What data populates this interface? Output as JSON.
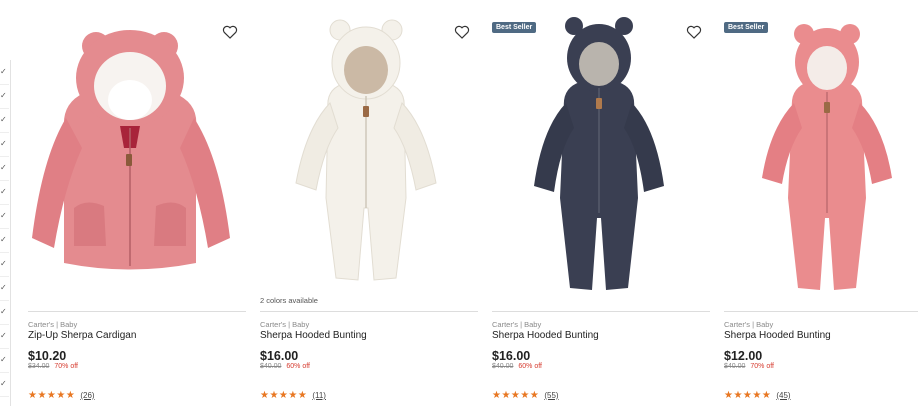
{
  "filter_checks": [
    "✓",
    "✓",
    "✓",
    "✓",
    "✓",
    "✓",
    "✓",
    "✓",
    "✓",
    "✓",
    "✓",
    "✓",
    "✓",
    "✓"
  ],
  "colors": {
    "accent_orange": "#e87722",
    "sale_red": "#d63b2f",
    "badge_blue": "#4f6a83",
    "pink": "#e48b8f",
    "cream": "#f4f1ea",
    "navy": "#3a3f52",
    "coral": "#ea8c8e"
  },
  "products": [
    {
      "image": "pink-sherpa-cardigan",
      "badge": "",
      "colors_available": "",
      "brand": "Carter's | Baby",
      "name": "Zip-Up Sherpa Cardigan",
      "price": "$10.20",
      "was": "$34.00",
      "off": "70% off",
      "stars": "★★★★★",
      "reviews": "(26)"
    },
    {
      "image": "white-sherpa-bunting",
      "badge": "",
      "colors_available": "2 colors available",
      "brand": "Carter's | Baby",
      "name": "Sherpa Hooded Bunting",
      "price": "$16.00",
      "was": "$40.00",
      "off": "60% off",
      "stars": "★★★★★",
      "reviews": "(11)"
    },
    {
      "image": "navy-sherpa-bunting",
      "badge": "Best Seller",
      "colors_available": "",
      "brand": "Carter's | Baby",
      "name": "Sherpa Hooded Bunting",
      "price": "$16.00",
      "was": "$40.00",
      "off": "60% off",
      "stars": "★★★★★",
      "reviews": "(55)"
    },
    {
      "image": "pink-sherpa-bunting",
      "badge": "Best Seller",
      "colors_available": "",
      "brand": "Carter's | Baby",
      "name": "Sherpa Hooded Bunting",
      "price": "$12.00",
      "was": "$40.00",
      "off": "70% off",
      "stars": "★★★★★",
      "reviews": "(45)"
    }
  ]
}
